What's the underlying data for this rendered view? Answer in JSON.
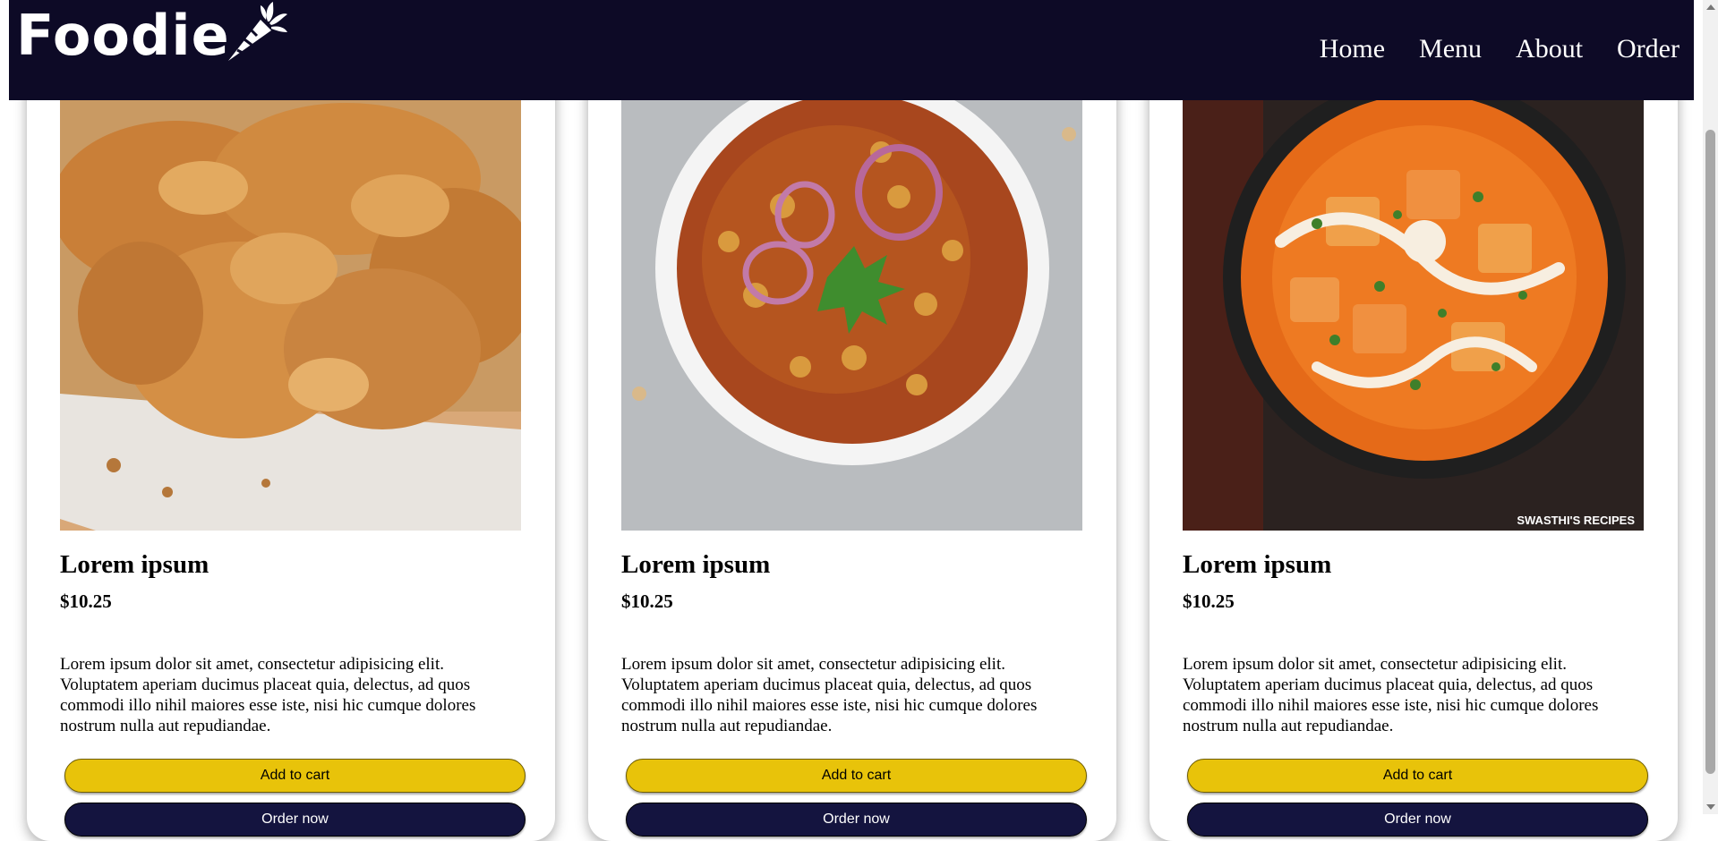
{
  "brand": {
    "name": "Foodie"
  },
  "nav": {
    "items": [
      "Home",
      "Menu",
      "About",
      "Order"
    ]
  },
  "cards": [
    {
      "title": "Lorem ipsum",
      "price": "$10.25",
      "description": "Lorem ipsum dolor sit amet, consectetur adipisicing elit. Voluptatem aperiam ducimus placeat quia, delectus, ad quos commodi illo nihil maiores esse iste, nisi hic cumque dolores nostrum nulla aut repudiandae.",
      "add_label": "Add to cart",
      "order_label": "Order now",
      "image": "fried-chicken-image"
    },
    {
      "title": "Lorem ipsum",
      "price": "$10.25",
      "description": "Lorem ipsum dolor sit amet, consectetur adipisicing elit. Voluptatem aperiam ducimus placeat quia, delectus, ad quos commodi illo nihil maiores esse iste, nisi hic cumque dolores nostrum nulla aut repudiandae.",
      "add_label": "Add to cart",
      "order_label": "Order now",
      "image": "chickpea-curry-image"
    },
    {
      "title": "Lorem ipsum",
      "price": "$10.25",
      "description": "Lorem ipsum dolor sit amet, consectetur adipisicing elit. Voluptatem aperiam ducimus placeat quia, delectus, ad quos commodi illo nihil maiores esse iste, nisi hic cumque dolores nostrum nulla aut repudiandae.",
      "add_label": "Add to cart",
      "order_label": "Order now",
      "image": "paneer-curry-image",
      "watermark": "SWASTHI'S RECIPES"
    }
  ],
  "colors": {
    "navbar": "#0d0a26",
    "add_button": "#e8c30a",
    "order_button": "#14143f"
  }
}
